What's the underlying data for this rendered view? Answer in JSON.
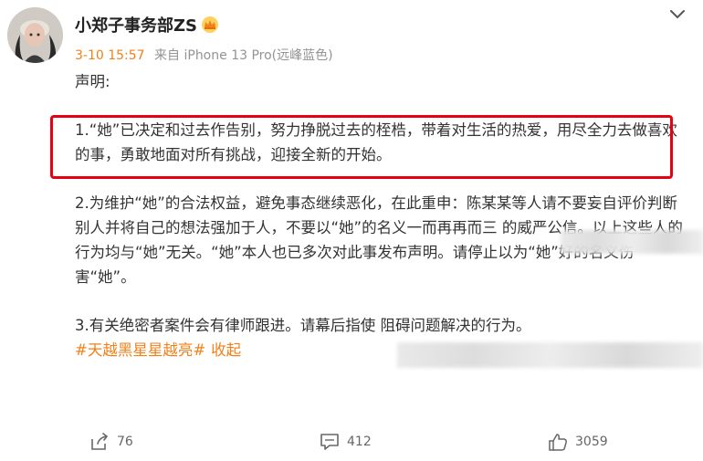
{
  "author": {
    "name": "小郑子事务部ZS"
  },
  "meta": {
    "time": "3-10 15:57",
    "source": "来自 iPhone 13 Pro(远峰蓝色)"
  },
  "post": {
    "heading": "声明:",
    "p1": "1.“她”已决定和过去作告别，努力挣脱过去的桎梏，带着对生活的热爱，用尽全力去做喜欢的事，勇敢地面对所有挑战，迎接全新的开始。",
    "p2": "2.为维护“她”的合法权益，避免事态继续恶化，在此重申：陈某某等人请不要妄自评价判断别人并将自己的想法强加于人，不要以“她”的名义一而再再而三 的威严公信。以上这些人的行为均与“她”无关。“她”本人也已多次对此事发布声明。请停止以为“她”好的名义伤害“她”。",
    "p3": "3.有关绝密者案件会有律师跟进。请幕后指使 阻碍问题解决的行为。",
    "hashtag": "#天越黑星星越亮#",
    "collapse": "收起"
  },
  "actions": {
    "share_count": "76",
    "comment_count": "412",
    "like_count": "3059"
  },
  "colors": {
    "accent": "#f08019",
    "highlight_border": "#e60012"
  }
}
